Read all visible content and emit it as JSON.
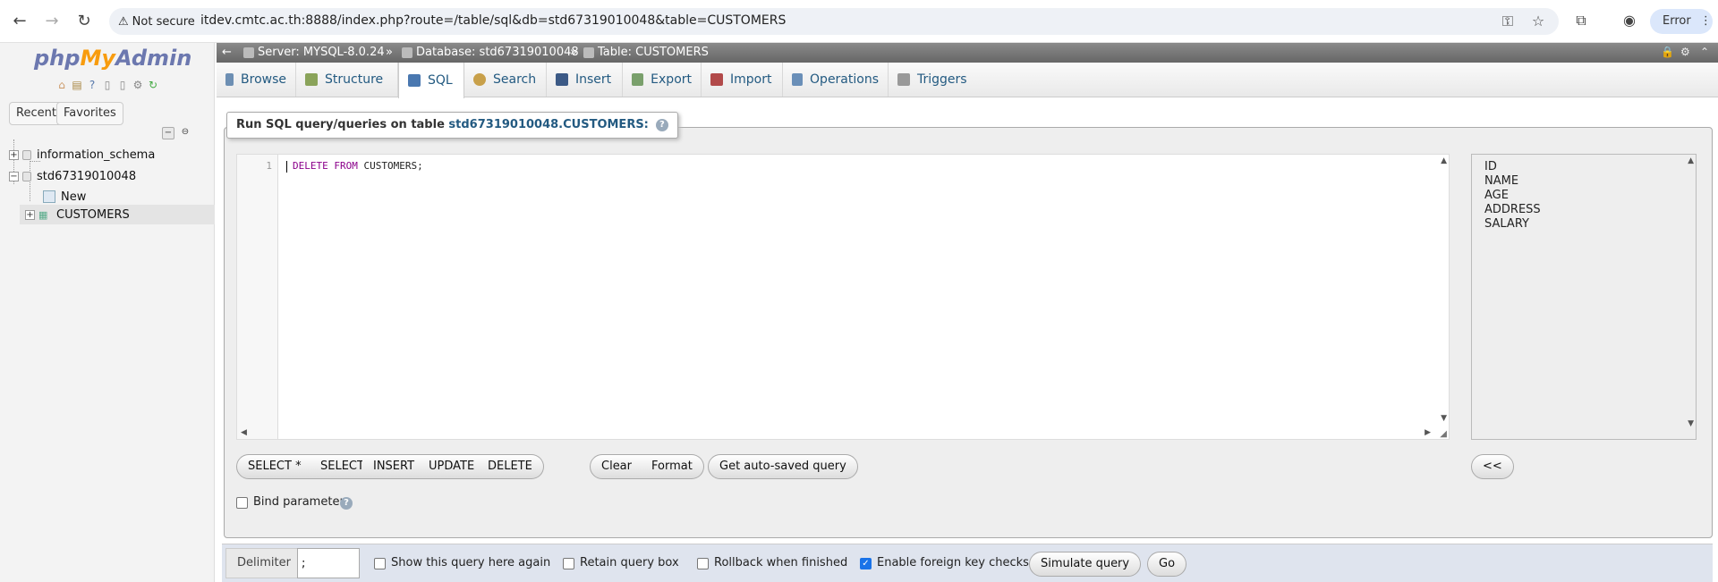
{
  "browser": {
    "not_secure": "Not secure",
    "url": "itdev.cmtc.ac.th:8888/index.php?route=/table/sql&db=std67319010048&table=CUSTOMERS",
    "error_label": "Error"
  },
  "leftnav": {
    "logo_php": "php",
    "logo_my": "My",
    "logo_admin": "Admin",
    "tab_recent": "Recent",
    "tab_favorites": "Favorites",
    "tree": {
      "db1": "information_schema",
      "db2": "std67319010048",
      "new": "New",
      "table": "CUSTOMERS"
    }
  },
  "serverbar": {
    "server": "Server: MYSQL-8.0.24",
    "database": "Database: std67319010048",
    "table": "Table: CUSTOMERS",
    "sep": "»"
  },
  "tabs": [
    {
      "label": "Browse",
      "color": "#6d8fb3"
    },
    {
      "label": "Structure",
      "color": "#8aa35a"
    },
    {
      "label": "SQL",
      "color": "#4a78b0"
    },
    {
      "label": "Search",
      "color": "#c8a04a"
    },
    {
      "label": "Insert",
      "color": "#3c5a86"
    },
    {
      "label": "Export",
      "color": "#7aa06c"
    },
    {
      "label": "Import",
      "color": "#b24a4a"
    },
    {
      "label": "Operations",
      "color": "#6a8fb8"
    },
    {
      "label": "Triggers",
      "color": "#999999"
    }
  ],
  "sql_panel": {
    "legend_prefix": "Run SQL query/queries on table ",
    "legend_table": "std67319010048.CUSTOMERS:",
    "line_number": "1",
    "code_keyword": "DELETE FROM",
    "code_rest": " CUSTOMERS;",
    "columns": [
      "ID",
      "NAME",
      "AGE",
      "ADDRESS",
      "SALARY"
    ]
  },
  "buttons": {
    "select_star": "SELECT *",
    "select": "SELECT",
    "insert": "INSERT",
    "update": "UPDATE",
    "delete": "DELETE",
    "clear": "Clear",
    "format": "Format",
    "autosaved": "Get auto-saved query",
    "insert_col": "<<"
  },
  "options": {
    "bind_parameters": "Bind parameters"
  },
  "footer": {
    "delimiter_label": "Delimiter",
    "delimiter_value": ";",
    "show_query": "Show this query here again",
    "retain_box": "Retain query box",
    "rollback": "Rollback when finished",
    "foreign_keys": "Enable foreign key checks",
    "simulate": "Simulate query",
    "go": "Go"
  }
}
